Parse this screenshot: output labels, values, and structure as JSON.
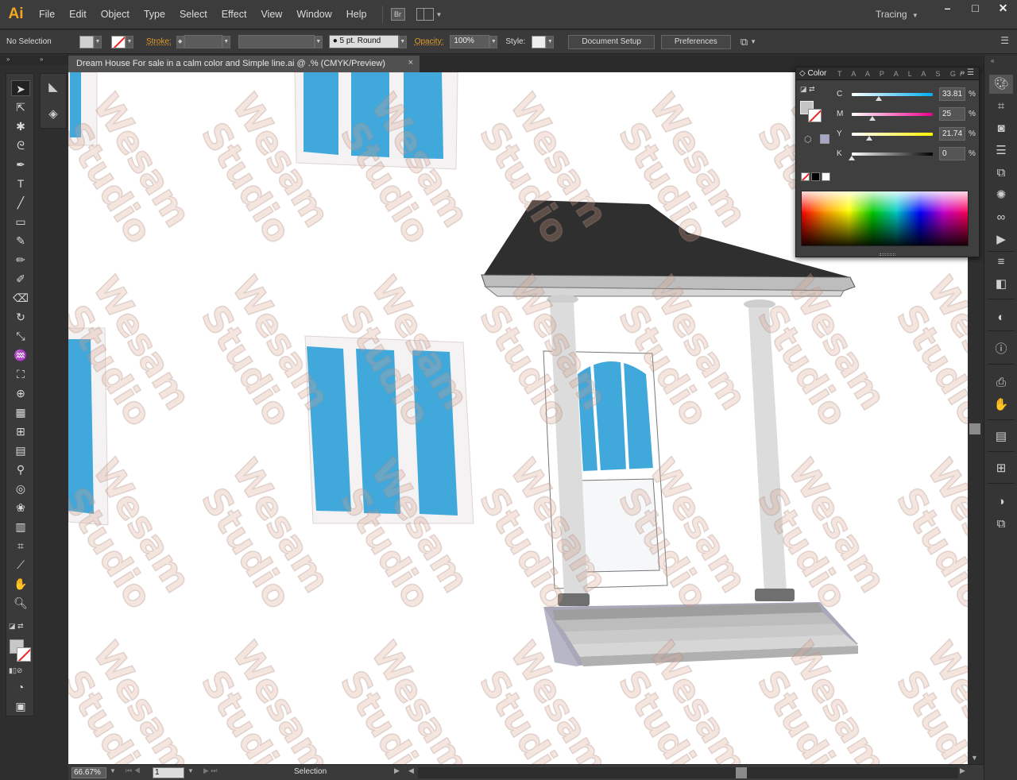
{
  "app": {
    "logo": "Ai",
    "menu": [
      "File",
      "Edit",
      "Object",
      "Type",
      "Select",
      "Effect",
      "View",
      "Window",
      "Help"
    ],
    "bridge_label": "Br",
    "workspace": "Tracing",
    "window_controls": [
      "–",
      "□",
      "✕"
    ]
  },
  "control_bar": {
    "selection": "No Selection",
    "stroke_label": "Stroke:",
    "brush": "5 pt. Round",
    "opacity_label": "Opacity:",
    "opacity_value": "100%",
    "style_label": "Style:",
    "document_setup": "Document Setup",
    "preferences": "Preferences"
  },
  "document": {
    "tab_title": "Dream House For sale in a calm color and Simple line.ai @ .% (CMYK/Preview)",
    "close": "×"
  },
  "watermark": {
    "line1": "Wesam",
    "line2": "Studio"
  },
  "color_panel": {
    "tab": "Color",
    "other_tabs": "T A A P A L A S Gr",
    "channels": [
      {
        "label": "C",
        "value": "33.81",
        "fraction": 0.338,
        "gradient": "linear-gradient(to right,#fff,#00aeef)"
      },
      {
        "label": "M",
        "value": "25",
        "fraction": 0.25,
        "gradient": "linear-gradient(to right,#fff,#ec008c)"
      },
      {
        "label": "Y",
        "value": "21.74",
        "fraction": 0.217,
        "gradient": "linear-gradient(to right,#fff,#fff200)"
      },
      {
        "label": "K",
        "value": "0",
        "fraction": 0.0,
        "gradient": "linear-gradient(to right,#fff,#000)"
      }
    ],
    "percent": "%"
  },
  "status_bar": {
    "zoom": "66.67%",
    "page": "1",
    "mode": "Selection"
  },
  "colors": {
    "accent": "#f5a623",
    "window_blue": "#41a8dc",
    "roof": "#333333",
    "column": "#dadada"
  }
}
